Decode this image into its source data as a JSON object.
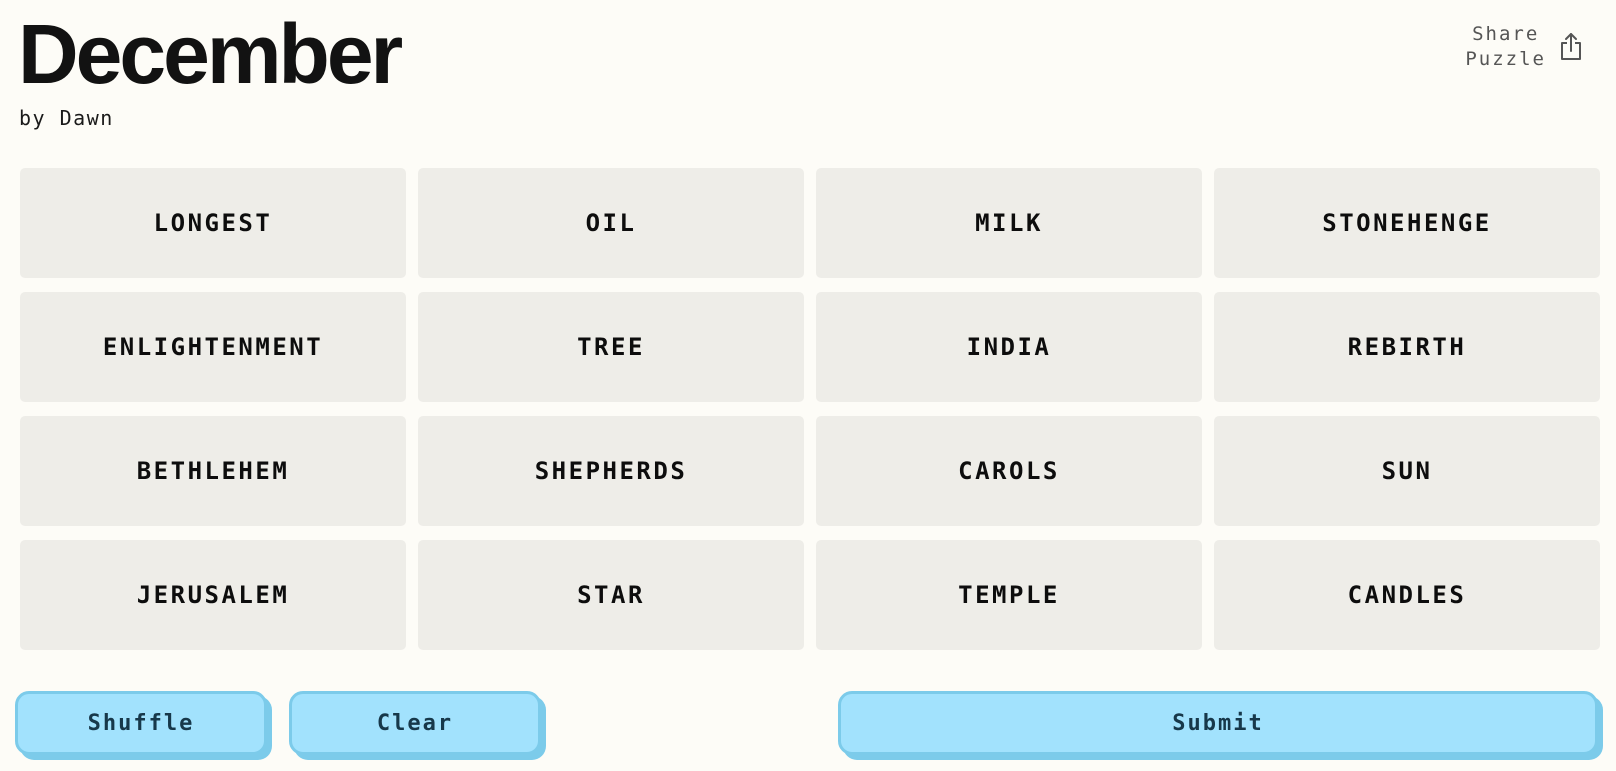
{
  "puzzle": {
    "title": "December",
    "author": "by Dawn"
  },
  "share": {
    "line1": "Share",
    "line2": "Puzzle",
    "icon": "share-icon"
  },
  "tiles": [
    "LONGEST",
    "OIL",
    "MILK",
    "STONEHENGE",
    "ENLIGHTENMENT",
    "TREE",
    "INDIA",
    "REBIRTH",
    "BETHLEHEM",
    "SHEPHERDS",
    "CAROLS",
    "SUN",
    "JERUSALEM",
    "STAR",
    "TEMPLE",
    "CANDLES"
  ],
  "controls": {
    "shuffle_label": "Shuffle",
    "clear_label": "Clear",
    "submit_label": "Submit"
  },
  "colors": {
    "background": "#fdfcf7",
    "tile": "#eeede8",
    "button": "#a2e2fd",
    "button_border": "#7ccbea",
    "button_text": "#17384a"
  }
}
